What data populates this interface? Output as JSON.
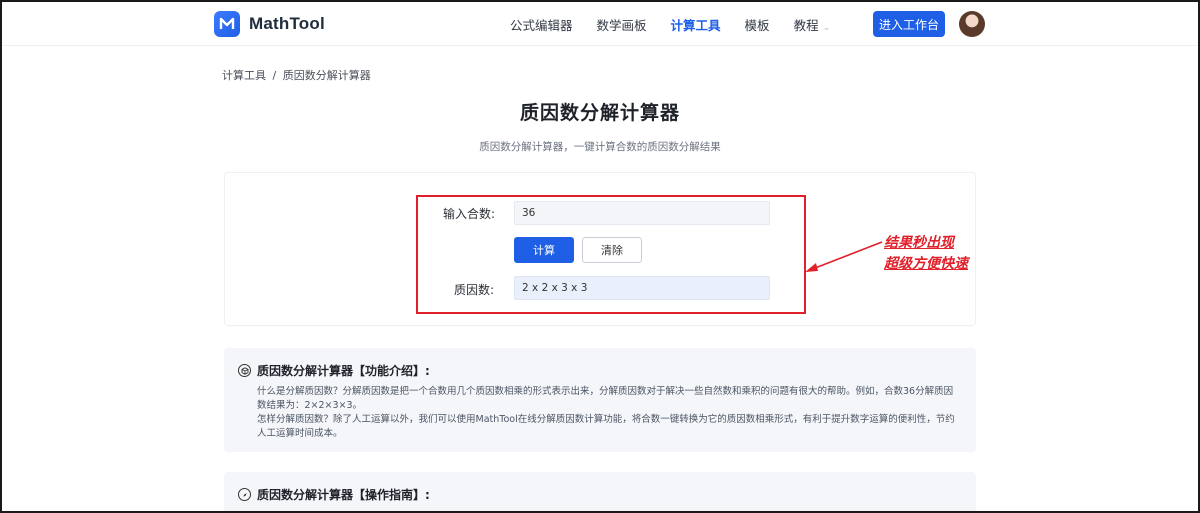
{
  "header": {
    "brand": "MathTool",
    "nav": [
      {
        "label": "公式编辑器",
        "active": false
      },
      {
        "label": "数学画板",
        "active": false
      },
      {
        "label": "计算工具",
        "active": true
      },
      {
        "label": "模板",
        "active": false
      },
      {
        "label": "教程",
        "active": false,
        "has_dropdown": true
      }
    ],
    "enter_button": "进入工作台",
    "avatar_icon": "user-avatar"
  },
  "breadcrumb": [
    "计算工具",
    "/",
    "质因数分解计算器"
  ],
  "page": {
    "title": "质因数分解计算器",
    "subtitle": "质因数分解计算器，一键计算合数的质因数分解结果"
  },
  "calculator": {
    "input_label": "输入合数:",
    "input_value": "36",
    "calc_button": "计算",
    "clear_button": "清除",
    "result_label": "质因数:",
    "result_value": "2 x 2 x 3 x 3"
  },
  "annotation": {
    "line1": "结果秒出现",
    "line2": "超级方便快速",
    "color": "#e0202a"
  },
  "sections": [
    {
      "icon": "cube-icon",
      "title": "质因数分解计算器【功能介绍】:",
      "paragraphs": [
        "什么是分解质因数？分解质因数是把一个合数用几个质因数相乘的形式表示出来，分解质因数对于解决一些自然数和乘积的问题有很大的帮助。例如，合数36分解质因数结果为：2×2×3×3。",
        "怎样分解质因数？除了人工运算以外，我们可以使用MathTool在线分解质因数计算功能，将合数一键转换为它的质因数相乘形式，有利于提升数字运算的便利性，节约人工运算时间成本。"
      ]
    },
    {
      "icon": "compass-icon",
      "title": "质因数分解计算器【操作指南】:",
      "paragraphs": []
    }
  ],
  "colors": {
    "primary": "#1e5fe6",
    "accent_red": "#e0202a"
  }
}
